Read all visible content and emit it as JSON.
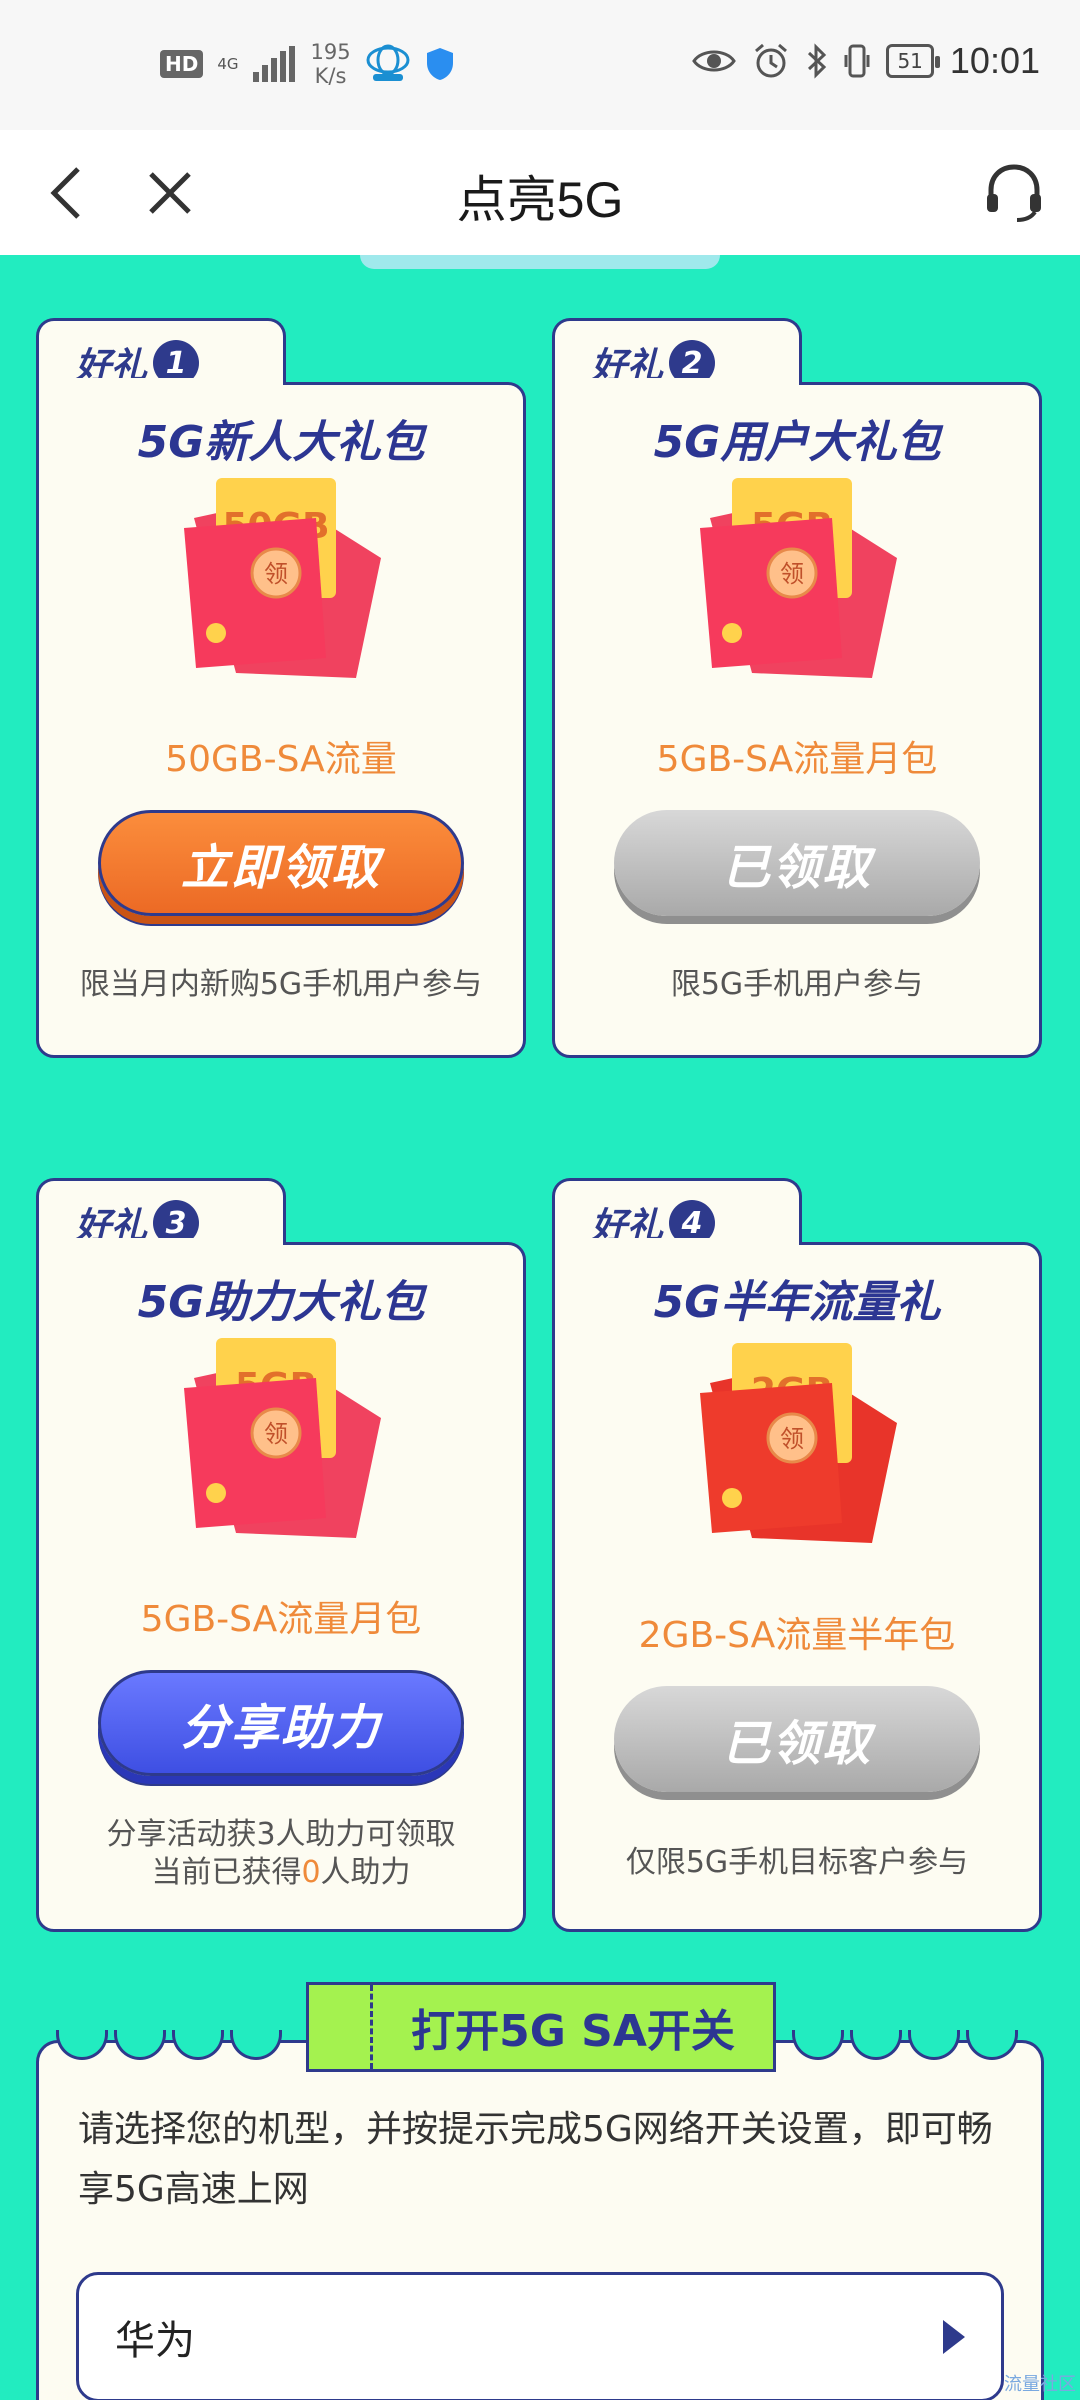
{
  "status_bar": {
    "hd": "HD",
    "network": "4G",
    "speed_value": "195",
    "speed_unit": "K/s",
    "battery": "51",
    "time": "10:01"
  },
  "header": {
    "title": "点亮5G"
  },
  "gifts": [
    {
      "tab_label": "好礼",
      "tab_number": "1",
      "title": "5G新人大礼包",
      "packet_label": "50GB",
      "packet_stamp": "领",
      "description": "50GB-SA流量",
      "button_label": "立即领取",
      "note": "限当月内新购5G手机用户参与"
    },
    {
      "tab_label": "好礼",
      "tab_number": "2",
      "title": "5G用户大礼包",
      "packet_label": "5GB",
      "packet_stamp": "领",
      "description": "5GB-SA流量月包",
      "button_label": "已领取",
      "note": "限5G手机用户参与"
    },
    {
      "tab_label": "好礼",
      "tab_number": "3",
      "title": "5G助力大礼包",
      "packet_label": "5GB",
      "packet_stamp": "领",
      "description": "5GB-SA流量月包",
      "button_label": "分享助力",
      "note_line1": "分享活动获3人助力可领取",
      "note_line2_prefix": "当前已获得",
      "note_line2_count": "0",
      "note_line2_suffix": "人助力"
    },
    {
      "tab_label": "好礼",
      "tab_number": "4",
      "title": "5G半年流量礼",
      "packet_label": "2GB",
      "packet_stamp": "领",
      "description": "2GB-SA流量半年包",
      "button_label": "已领取",
      "note": "仅限5G手机目标客户参与"
    }
  ],
  "sa_switch": {
    "banner": "打开5G SA开关",
    "description": "请选择您的机型，并按提示完成5G网络开关设置，即可畅享5G高速上网",
    "brand_value": "华为"
  },
  "watermark": "流量社区",
  "colors": {
    "background": "#22ecc0",
    "card_border": "#2e3a8c",
    "accent_orange": "#ef8a3a",
    "button_blue": "#4a5bef",
    "banner_green": "#a4f24f"
  }
}
